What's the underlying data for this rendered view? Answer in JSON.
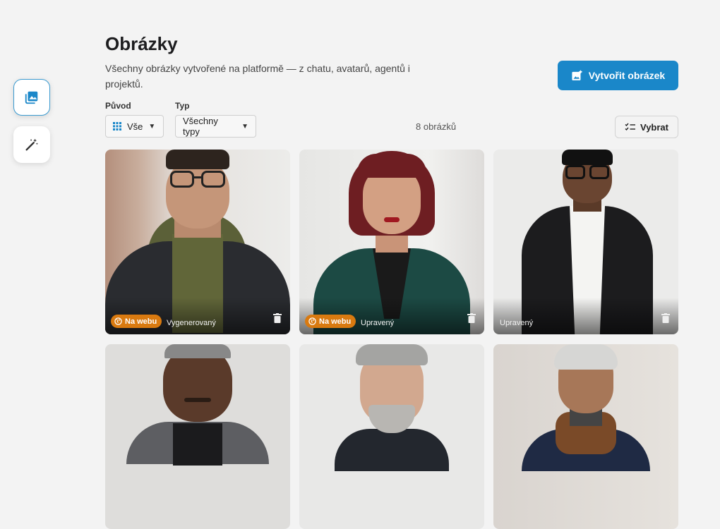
{
  "page": {
    "title": "Obrázky",
    "description": "Všechny obrázky vytvořené na platformě — z chatu, avatarů, agentů i projektů."
  },
  "rail": {
    "items": [
      {
        "icon": "image-gallery-icon",
        "active": true
      },
      {
        "icon": "magic-wand-icon",
        "active": false
      }
    ]
  },
  "create_button": {
    "label": "Vytvořit obrázek",
    "icon": "add-image-icon"
  },
  "filters": {
    "origin": {
      "label": "Původ",
      "value": "Vše",
      "icon": "grid-icon"
    },
    "type": {
      "label": "Typ",
      "value": "Všechny typy"
    }
  },
  "count_text": "8 obrázků",
  "select_button": {
    "label": "Vybrat",
    "icon": "checklist-icon"
  },
  "colors": {
    "accent": "#1a87c9",
    "badge": "#d97a10",
    "background": "#f3f3f3"
  },
  "images": [
    {
      "badge": "Na webu",
      "status": "Vygenerovaný",
      "subject": "young man with glasses, olive hoodie, denim jacket"
    },
    {
      "badge": "Na webu",
      "status": "Upravený",
      "subject": "woman with burgundy bob, green blazer"
    },
    {
      "badge": null,
      "status": "Upravený",
      "subject": "woman with glasses, black blazer, white shirt"
    },
    {
      "badge": null,
      "status": null,
      "subject": "man with mustache, grey blazer"
    },
    {
      "badge": null,
      "status": null,
      "subject": "older man with grey hair and beard"
    },
    {
      "badge": null,
      "status": null,
      "subject": "older woman with grey hair, scarf"
    }
  ]
}
